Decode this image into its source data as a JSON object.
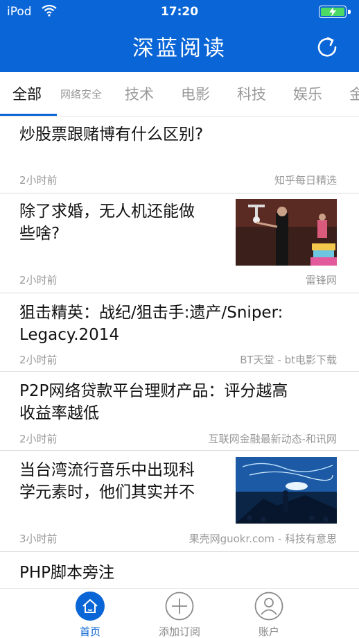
{
  "status_bar": {
    "carrier": "iPod",
    "time": "17:20"
  },
  "header": {
    "title": "深蓝阅读"
  },
  "tabs": [
    {
      "label": "全部",
      "active": true
    },
    {
      "label": "网络安全"
    },
    {
      "label": "技术"
    },
    {
      "label": "电影"
    },
    {
      "label": "科技"
    },
    {
      "label": "娱乐"
    },
    {
      "label": "金"
    }
  ],
  "articles": [
    {
      "title": "炒股票跟赌博有什么区别?",
      "time": "2小时前",
      "source": "知乎每日精选"
    },
    {
      "title": "除了求婚，无人机还能做\n些啥?",
      "time": "2小时前",
      "source": "雷锋网"
    },
    {
      "title": "狙击精英：战纪/狙击手:遗产/Sniper:\nLegacy.2014",
      "time": "2小时前",
      "source": "BT天堂 - bt电影下载"
    },
    {
      "title": "P2P网络贷款平台理财产品：评分越高\n收益率越低",
      "time": "2小时前",
      "source": "互联网金融最新动态-和讯网"
    },
    {
      "title": "当台湾流行音乐中出现科\n学元素时，他们其实并不",
      "time": "3小时前",
      "source": "果壳网guokr.com - 科技有意思"
    },
    {
      "title": "PHP脚本旁注"
    }
  ],
  "tabbar": [
    {
      "label": "首页",
      "icon": "home-icon",
      "active": true
    },
    {
      "label": "添加订阅",
      "icon": "plus-circle-icon"
    },
    {
      "label": "账户",
      "icon": "user-icon"
    }
  ],
  "colors": {
    "brand": "#0a66d6",
    "battery": "#4cd964"
  }
}
